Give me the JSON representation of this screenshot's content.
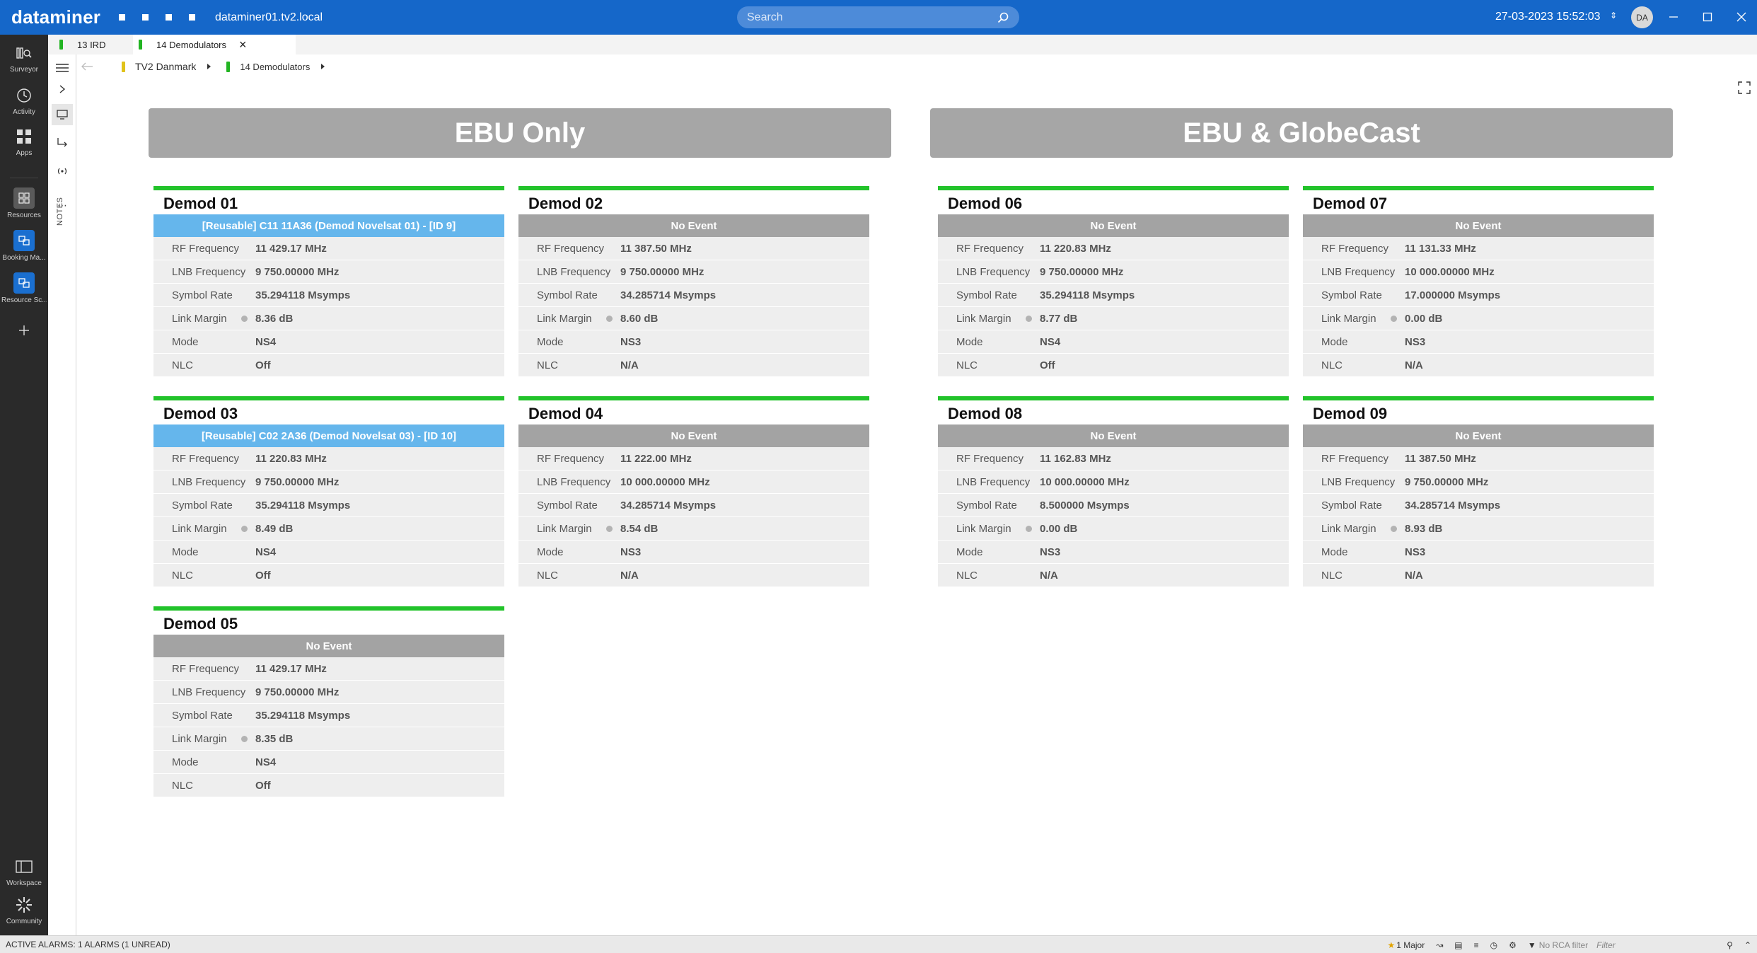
{
  "titlebar": {
    "logo": "dataminer",
    "hostname": "dataminer01.tv2.local",
    "search_placeholder": "Search",
    "datetime": "27-03-2023 15:52:03",
    "user_initials": "DA"
  },
  "nav": {
    "surveyor": "Surveyor",
    "activity": "Activity",
    "apps": "Apps",
    "resources": "Resources",
    "booking": "Booking Ma...",
    "resource_sc": "Resource Sc...",
    "workspace": "Workspace",
    "community": "Community"
  },
  "tabs": [
    {
      "label": "13 IRD"
    },
    {
      "label": "14 Demodulators"
    }
  ],
  "tools": {
    "notes": "NOTES"
  },
  "breadcrumb": {
    "items": [
      {
        "label": "TV2 Danmark",
        "color": "#e0c21a"
      },
      {
        "label": "14 Demodulators",
        "color": "#22b422"
      }
    ]
  },
  "sections": {
    "left": "EBU Only",
    "right": "EBU & GlobeCast"
  },
  "labels": {
    "rf": "RF Frequency",
    "lnb": "LNB Frequency",
    "sr": "Symbol Rate",
    "lm": "Link Margin",
    "mode": "Mode",
    "nlc": "NLC"
  },
  "demods": [
    {
      "name": "Demod 01",
      "event": "[Reusable] C11 11A36 (Demod Novelsat 01) - [ID 9]",
      "reserved": true,
      "rf": "11 429.17 MHz",
      "lnb": "9 750.00000 MHz",
      "sr": "35.294118 Msymps",
      "lm": "8.36 dB",
      "mode": "NS4",
      "nlc": "Off"
    },
    {
      "name": "Demod 02",
      "event": "No Event",
      "reserved": false,
      "rf": "11 387.50 MHz",
      "lnb": "9 750.00000 MHz",
      "sr": "34.285714 Msymps",
      "lm": "8.60 dB",
      "mode": "NS3",
      "nlc": "N/A"
    },
    {
      "name": "Demod 03",
      "event": "[Reusable] C02 2A36  (Demod Novelsat 03) - [ID 10]",
      "reserved": true,
      "rf": "11 220.83 MHz",
      "lnb": "9 750.00000 MHz",
      "sr": "35.294118 Msymps",
      "lm": "8.49 dB",
      "mode": "NS4",
      "nlc": "Off"
    },
    {
      "name": "Demod 04",
      "event": "No Event",
      "reserved": false,
      "rf": "11 222.00 MHz",
      "lnb": "10 000.00000 MHz",
      "sr": "34.285714 Msymps",
      "lm": "8.54 dB",
      "mode": "NS3",
      "nlc": "N/A"
    },
    {
      "name": "Demod 05",
      "event": "No Event",
      "reserved": false,
      "rf": "11 429.17 MHz",
      "lnb": "9 750.00000 MHz",
      "sr": "35.294118 Msymps",
      "lm": "8.35 dB",
      "mode": "NS4",
      "nlc": "Off"
    },
    {
      "name": "Demod 06",
      "event": "No Event",
      "reserved": false,
      "rf": "11 220.83 MHz",
      "lnb": "9 750.00000 MHz",
      "sr": "35.294118 Msymps",
      "lm": "8.77 dB",
      "mode": "NS4",
      "nlc": "Off"
    },
    {
      "name": "Demod 07",
      "event": "No Event",
      "reserved": false,
      "rf": "11 131.33 MHz",
      "lnb": "10 000.00000 MHz",
      "sr": "17.000000 Msymps",
      "lm": "0.00 dB",
      "mode": "NS3",
      "nlc": "N/A"
    },
    {
      "name": "Demod 08",
      "event": "No Event",
      "reserved": false,
      "rf": "11 162.83 MHz",
      "lnb": "10 000.00000 MHz",
      "sr": "8.500000 Msymps",
      "lm": "0.00 dB",
      "mode": "NS3",
      "nlc": "N/A"
    },
    {
      "name": "Demod 09",
      "event": "No Event",
      "reserved": false,
      "rf": "11 387.50 MHz",
      "lnb": "9 750.00000 MHz",
      "sr": "34.285714 Msymps",
      "lm": "8.93 dB",
      "mode": "NS3",
      "nlc": "N/A"
    }
  ],
  "statusbar": {
    "alarms": "ACTIVE ALARMS: 1 ALARMS (1 UNREAD)",
    "major": "1 Major",
    "rca": "No RCA filter",
    "filter_placeholder": "Filter"
  }
}
